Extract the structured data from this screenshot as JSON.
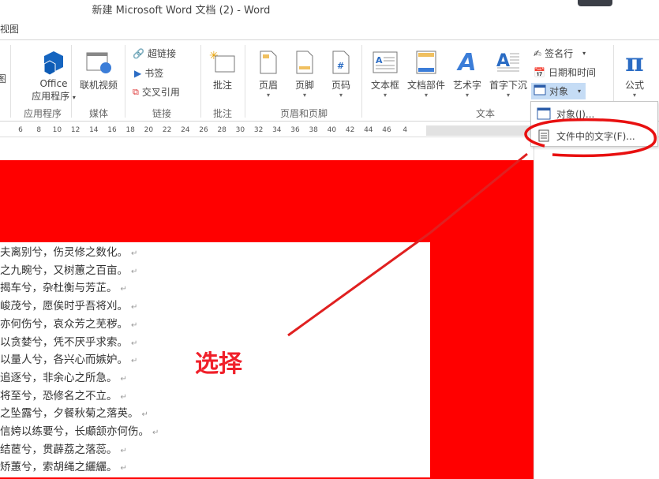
{
  "window": {
    "title": "新建 Microsoft Word 文档 (2) - Word"
  },
  "tabs": {
    "view": "视图"
  },
  "ribbon": {
    "partial_left": "图",
    "office_apps": {
      "line1": "Office",
      "line2": "应用程序"
    },
    "online_video": "联机视频",
    "hyperlink": "超链接",
    "bookmark": "书签",
    "cross_ref": "交叉引用",
    "comment": "批注",
    "header": "页眉",
    "footer": "页脚",
    "page_number": "页码",
    "textbox": "文本框",
    "quick_parts": "文档部件",
    "wordart": "艺术字",
    "dropcap": "首字下沉",
    "signature_line": "签名行",
    "date_time": "日期和时间",
    "object": "对象",
    "equation": "公式",
    "groups": {
      "apps": "应用程序",
      "media": "媒体",
      "links": "链接",
      "comments": "批注",
      "header_footer": "页眉和页脚",
      "text": "文本"
    }
  },
  "object_menu": {
    "items": [
      {
        "label": "对象(J)..."
      },
      {
        "label": "文件中的文字(F)..."
      }
    ]
  },
  "ruler": {
    "ticks": [
      "6",
      "8",
      "10",
      "12",
      "14",
      "16",
      "18",
      "20",
      "22",
      "24",
      "26",
      "28",
      "30",
      "32",
      "34",
      "36",
      "38",
      "40",
      "42",
      "44",
      "46",
      "4"
    ]
  },
  "document": {
    "lines": [
      "夫离别兮，伤灵修之数化。",
      "之九畹兮，又树蕙之百亩。",
      "揭车兮，杂杜衡与芳芷。",
      "峻茂兮，愿俟时乎吾将刈。",
      "亦何伤兮，哀众芳之芜秽。",
      "以贪婪兮，凭不厌乎求索。",
      "以量人兮，各兴心而嫉妒。",
      "追逐兮，非余心之所急。",
      "将至兮，恐修名之不立。",
      "之坠露兮，夕餐秋菊之落英。",
      "信姱以练要兮，长顑颔亦何伤。",
      "结茝兮，贯薜荔之落蕊。",
      "矫蕙兮，索胡绳之纚纚。"
    ]
  },
  "annotation": {
    "text": "选择",
    "color": "#f0202a"
  },
  "colors": {
    "accent": "#2b6cc4",
    "highlight": "#c5dcf5",
    "red_overlay": "#ff0000"
  }
}
